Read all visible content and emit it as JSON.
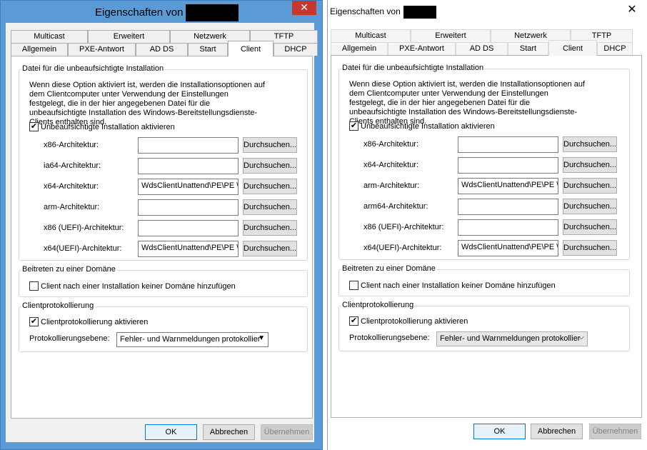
{
  "dialog": {
    "title": "Eigenschaften von",
    "tabs_top": [
      "Multicast",
      "Erweitert",
      "Netzwerk",
      "TFTP"
    ],
    "tabs_bottom": [
      "Allgemein",
      "PXE-Antwort",
      "AD DS",
      "Start",
      "Client",
      "DHCP"
    ],
    "active_tab": "Client"
  },
  "unattend": {
    "legend": "Datei für die unbeaufsichtigte Installation",
    "description": "Wenn diese Option aktiviert ist, werden die Installationsoptionen auf dem Clientcomputer unter Verwendung der Einstellungen festgelegt, die in der hier angegebenen Datei für die unbeaufsichtigte Installation des Windows-Bereitstellungsdienste-Clients enthalten sind.",
    "enable_label": "Unbeaufsichtigte Installation aktivieren",
    "enable_checked": true,
    "browse_label": "Durchsuchen..."
  },
  "left": {
    "arch_rows": [
      {
        "label": "x86-Architektur:",
        "value": ""
      },
      {
        "label": "ia64-Architektur:",
        "value": ""
      },
      {
        "label": "x64-Architektur:",
        "value": "WdsClientUnattend\\PE\\PE \\"
      },
      {
        "label": "arm-Architektur:",
        "value": ""
      },
      {
        "label": "x86 (UEFI)-Architektur:",
        "value": ""
      },
      {
        "label": "x64(UEFI)-Architektur:",
        "value": "WdsClientUnattend\\PE\\PE \\"
      }
    ]
  },
  "right": {
    "arch_rows": [
      {
        "label": "x86-Architektur:",
        "value": ""
      },
      {
        "label": "x64-Architektur:",
        "value": ""
      },
      {
        "label": "arm-Architektur:",
        "value": "WdsClientUnattend\\PE\\PE \\"
      },
      {
        "label": "arm64-Architektur:",
        "value": ""
      },
      {
        "label": "x86 (UEFI)-Architektur:",
        "value": ""
      },
      {
        "label": "x64(UEFI)-Architektur:",
        "value": "WdsClientUnattend\\PE\\PE \\"
      }
    ]
  },
  "domain": {
    "legend": "Beitreten zu einer Domäne",
    "checkbox_label": "Client nach einer Installation keiner Domäne hinzufügen",
    "checked": false
  },
  "logging": {
    "legend": "Clientprotokollierung",
    "checkbox_label": "Clientprotokollierung aktivieren",
    "checked": true,
    "level_label": "Protokollierungsebene:",
    "level_value": "Fehler- und Warnmeldungen protokollier"
  },
  "buttons": {
    "ok": "OK",
    "cancel": "Abbrechen",
    "apply": "Übernehmen"
  },
  "colors": {
    "left_frame": "#5b9bd5",
    "close_red": "#c7372f",
    "default_button_border": "#0078d7"
  }
}
